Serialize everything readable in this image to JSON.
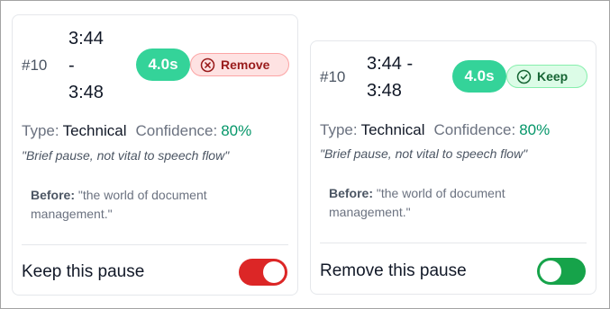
{
  "cards": [
    {
      "id": "#10",
      "time_start": "3:44",
      "time_sep": "-",
      "time_end": "3:48",
      "duration": "4.0s",
      "badge": {
        "label": "Remove",
        "icon": "x-circle-icon",
        "color": "#991b1b"
      },
      "type_label": "Type:",
      "type_value": "Technical",
      "confidence_label": "Confidence:",
      "confidence_value": "80%",
      "reason": "\"Brief pause, not vital to speech flow\"",
      "before_label": "Before:",
      "before_line1": "\"the world of document",
      "before_line2": "management.\"",
      "toggle_label": "Keep this pause",
      "toggle_state": true,
      "toggle_color": "#dc2626"
    },
    {
      "id": "#10",
      "time_start": "3:44 -",
      "time_end": "3:48",
      "duration": "4.0s",
      "badge": {
        "label": "Keep",
        "icon": "check-circle-icon",
        "color": "#166534"
      },
      "type_label": "Type:",
      "type_value": "Technical",
      "confidence_label": "Confidence:",
      "confidence_value": "80%",
      "reason": "\"Brief pause, not vital to speech flow\"",
      "before_label": "Before:",
      "before_line1": "\"the world of document",
      "before_line2": "management.\"",
      "toggle_label": "Remove this pause",
      "toggle_state": false,
      "toggle_color": "#16a34a"
    }
  ],
  "colors": {
    "duration_badge": "#34d399",
    "confidence": "#059669"
  }
}
